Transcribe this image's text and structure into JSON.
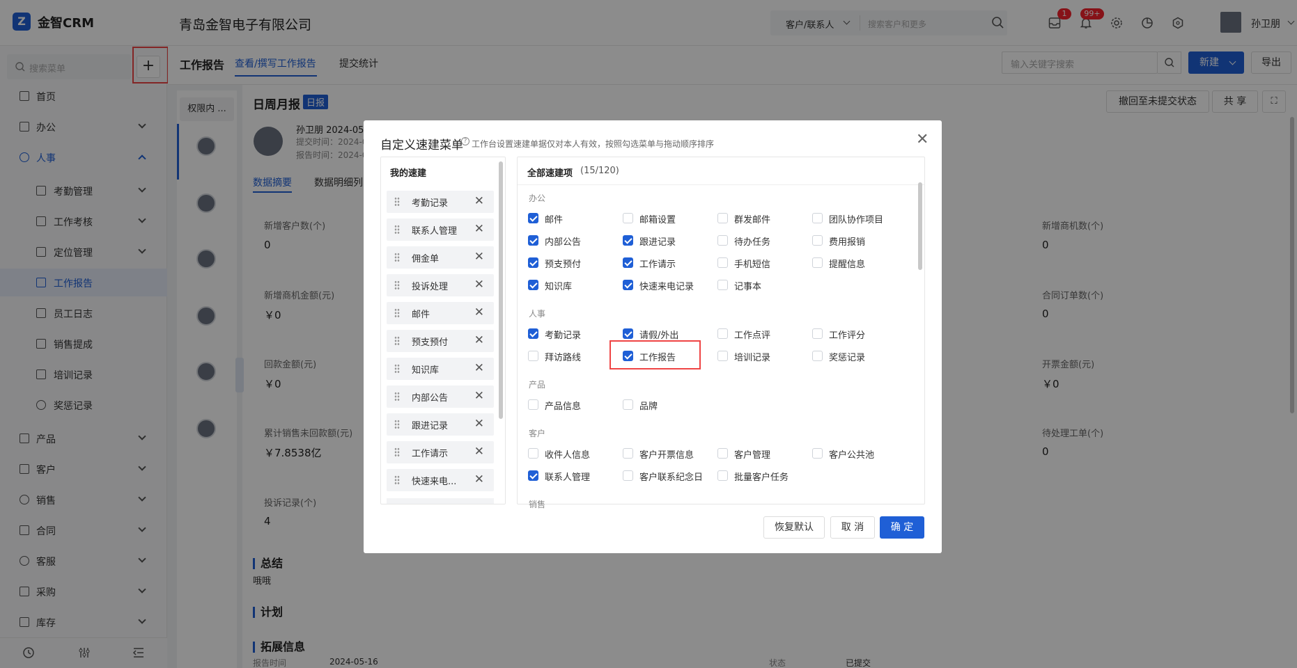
{
  "header": {
    "logo_glyph": "Z",
    "brand": "金智CRM",
    "company": "青岛金智电子有限公司",
    "search_scope": "客户/联系人",
    "search_placeholder": "搜索客户和更多",
    "mail_badge": "1",
    "bell_badge": "99+",
    "user_name": "孙卫朋"
  },
  "sidebar": {
    "search_placeholder": "搜索菜单",
    "add_label": "+",
    "items": [
      {
        "label": "首页",
        "icon": "home-icon"
      },
      {
        "label": "办公",
        "icon": "office-icon"
      },
      {
        "label": "人事",
        "icon": "people-icon"
      },
      {
        "label": "考勤管理",
        "icon": "copy-icon"
      },
      {
        "label": "工作考核",
        "icon": "copy-icon"
      },
      {
        "label": "定位管理",
        "icon": "copy-icon"
      },
      {
        "label": "工作报告",
        "icon": "report-icon"
      },
      {
        "label": "员工日志",
        "icon": "log-icon"
      },
      {
        "label": "销售提成",
        "icon": "commission-icon"
      },
      {
        "label": "培训记录",
        "icon": "training-icon"
      },
      {
        "label": "奖惩记录",
        "icon": "award-icon"
      },
      {
        "label": "产品",
        "icon": "box-icon"
      },
      {
        "label": "客户",
        "icon": "customer-icon"
      },
      {
        "label": "销售",
        "icon": "sales-icon"
      },
      {
        "label": "合同",
        "icon": "contract-icon"
      },
      {
        "label": "客服",
        "icon": "service-icon"
      },
      {
        "label": "采购",
        "icon": "purchase-icon"
      },
      {
        "label": "库存",
        "icon": "warehouse-icon"
      }
    ]
  },
  "subheader": {
    "section": "工作报告",
    "tab_active": "查看/撰写工作报告",
    "tab_other": "提交统计",
    "keyword_placeholder": "输入关键字搜索",
    "new_label": "新建",
    "export_label": "导出"
  },
  "report": {
    "filter_label": "权限内 ...",
    "title": "日周月报",
    "tag": "日报",
    "author": "孙卫朋 2024-05",
    "submit_time": "提交时间：2024-0",
    "report_time": "报告时间：2024-0",
    "btn_withdraw": "撤回至未提交状态",
    "btn_share": "共 享",
    "tab_summary": "数据摘要",
    "tab_detail": "数据明细列",
    "stats_left": [
      {
        "label": "新增客户数(个)",
        "value": "0"
      },
      {
        "label": "新增商机金额(元)",
        "value": "￥0"
      },
      {
        "label": "回款金额(元)",
        "value": "￥0"
      },
      {
        "label": "累计销售未回款额(元)",
        "value": "￥7.8538亿"
      },
      {
        "label": "投诉记录(个)",
        "value": "4"
      }
    ],
    "stats_right": [
      {
        "label": "新增商机数(个)",
        "value": "0"
      },
      {
        "label": "合同订单数(个)",
        "value": "0"
      },
      {
        "label": "开票金额(元)",
        "value": "￥0"
      },
      {
        "label": "待处理工单(个)",
        "value": "0"
      }
    ],
    "summary_title": "总结",
    "summary_text": "哦哦",
    "plan_title": "计划",
    "extend_title": "拓展信息",
    "extend_row": [
      "报告时间",
      "2024-05-16",
      "状态",
      "已提交"
    ]
  },
  "modal": {
    "title": "自定义速建菜单",
    "hint": "工作台设置速建单据仅对本人有效，按照勾选菜单与拖动顺序排序",
    "left_title": "我的速建",
    "my_items": [
      "考勤记录",
      "联系人管理",
      "佣金单",
      "投诉处理",
      "邮件",
      "预支预付",
      "知识库",
      "内部公告",
      "跟进记录",
      "工作请示",
      "快速来电..."
    ],
    "right_title": "全部速建项",
    "right_count": "(15/120)",
    "groups": [
      {
        "name": "办公",
        "items": [
          {
            "label": "邮件",
            "checked": true
          },
          {
            "label": "邮箱设置",
            "checked": false
          },
          {
            "label": "群发邮件",
            "checked": false
          },
          {
            "label": "团队协作项目",
            "checked": false
          },
          {
            "label": "内部公告",
            "checked": true
          },
          {
            "label": "跟进记录",
            "checked": true
          },
          {
            "label": "待办任务",
            "checked": false
          },
          {
            "label": "费用报销",
            "checked": false
          },
          {
            "label": "预支预付",
            "checked": true
          },
          {
            "label": "工作请示",
            "checked": true
          },
          {
            "label": "手机短信",
            "checked": false
          },
          {
            "label": "提醒信息",
            "checked": false
          },
          {
            "label": "知识库",
            "checked": true
          },
          {
            "label": "快速来电记录",
            "checked": true
          },
          {
            "label": "记事本",
            "checked": false
          }
        ]
      },
      {
        "name": "人事",
        "items": [
          {
            "label": "考勤记录",
            "checked": true
          },
          {
            "label": "请假/外出",
            "checked": true
          },
          {
            "label": "工作点评",
            "checked": false
          },
          {
            "label": "工作评分",
            "checked": false
          },
          {
            "label": "拜访路线",
            "checked": false
          },
          {
            "label": "工作报告",
            "checked": true
          },
          {
            "label": "培训记录",
            "checked": false
          },
          {
            "label": "奖惩记录",
            "checked": false
          }
        ]
      },
      {
        "name": "产品",
        "items": [
          {
            "label": "产品信息",
            "checked": false
          },
          {
            "label": "品牌",
            "checked": false
          }
        ]
      },
      {
        "name": "客户",
        "items": [
          {
            "label": "收件人信息",
            "checked": false
          },
          {
            "label": "客户开票信息",
            "checked": false
          },
          {
            "label": "客户管理",
            "checked": false
          },
          {
            "label": "客户公共池",
            "checked": false
          },
          {
            "label": "联系人管理",
            "checked": true
          },
          {
            "label": "客户联系纪念日",
            "checked": false
          },
          {
            "label": "批量客户任务",
            "checked": false
          }
        ]
      },
      {
        "name": "销售",
        "items": []
      }
    ],
    "btn_reset": "恢复默认",
    "btn_cancel": "取 消",
    "btn_ok": "确 定"
  },
  "colors": {
    "primary": "#1f5fd6",
    "highlight": "#ef4444"
  }
}
